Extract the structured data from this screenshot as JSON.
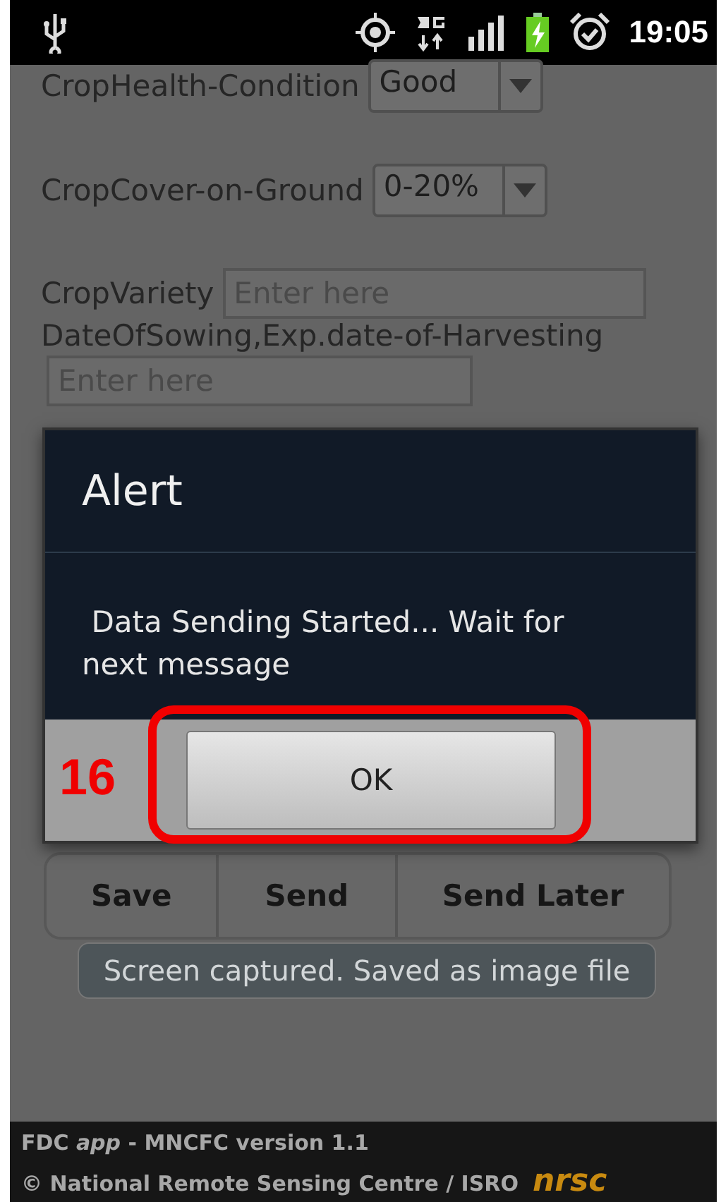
{
  "status_bar": {
    "time": "19:05"
  },
  "form": {
    "fields": [
      {
        "kind": "select",
        "label": "CropHealth-Condition",
        "value": "Good"
      },
      {
        "kind": "select",
        "label": "CropCover-on-Ground",
        "value": "0-20%"
      },
      {
        "kind": "input",
        "label": "CropVariety",
        "placeholder": "Enter here"
      },
      {
        "kind": "input-below",
        "label": "DateOfSowing,Exp.date-of-Harvesting",
        "placeholder": "Enter here"
      }
    ],
    "actions": [
      {
        "label": "Save"
      },
      {
        "label": "Send"
      },
      {
        "label": "Send Later"
      }
    ]
  },
  "dialog": {
    "title": "Alert",
    "message": " Data Sending Started... Wait for next message",
    "button": "OK",
    "annotation": "16"
  },
  "toast": "Screen captured. Saved as image file",
  "footer": {
    "line_1": "FDC *app* - MNCFC version 1.1",
    "line_2": "© National Remote Sensing Centre / ISRO",
    "logo": "nrsc"
  }
}
